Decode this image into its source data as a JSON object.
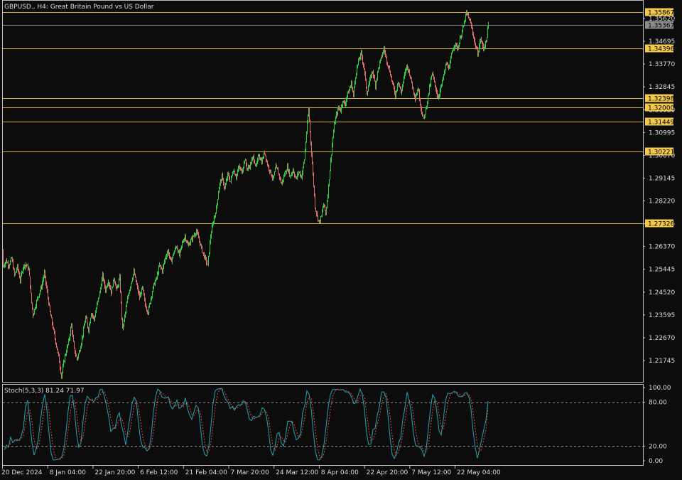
{
  "header": {
    "symbol_title": "GBPUSD., H4:  Great Britain Pound vs US Dollar"
  },
  "colors": {
    "background": "#0c0c0c",
    "frame": "#bdbdbd",
    "level_line": "#d8b233",
    "level_badge": "#f2c94c",
    "current_price_line": "#8a8a8a",
    "current_price_badge": "#8c8c8c",
    "bull_candle": "#2ecc40",
    "bear_candle": "#e06c6c",
    "stoch_main": "#1fa6b2",
    "stoch_signal": "#d94a4a",
    "stoch_levels": "#8a8a8a"
  },
  "chart_data": {
    "type": "candlestick",
    "symbol": "GBPUSD.",
    "timeframe": "H4",
    "price_axis_ticks": [
      "1.35620",
      "1.34695",
      "1.33770",
      "1.32845",
      "1.31920",
      "1.30995",
      "1.30070",
      "1.29145",
      "1.28220",
      "1.27295",
      "1.26370",
      "1.25445",
      "1.24520",
      "1.23595",
      "1.22670",
      "1.21745"
    ],
    "price_range": [
      1.2125,
      1.3605
    ],
    "horizontal_levels": [
      "1.35867",
      "1.34396",
      "1.32398",
      "1.32000",
      "1.31449",
      "1.30221",
      "1.27326"
    ],
    "current_price": "1.35367",
    "time_axis_labels": [
      "20 Dec 2024",
      "8 Jan 04:00",
      "22 Jan 20:00",
      "6 Feb 12:00",
      "21 Feb 04:00",
      "7 Mar 20:00",
      "24 Mar 12:00",
      "8 Apr 04:00",
      "22 Apr 20:00",
      "7 May 12:00",
      "22 May 04:00"
    ],
    "price_path": [
      [
        0,
        1.262
      ],
      [
        4,
        1.2555
      ],
      [
        8,
        1.258
      ],
      [
        12,
        1.256
      ],
      [
        16,
        1.259
      ],
      [
        20,
        1.252
      ],
      [
        24,
        1.2555
      ],
      [
        28,
        1.25
      ],
      [
        32,
        1.2555
      ],
      [
        36,
        1.2565
      ],
      [
        40,
        1.2545
      ],
      [
        44,
        1.241
      ],
      [
        46,
        1.236
      ],
      [
        52,
        1.2425
      ],
      [
        58,
        1.2475
      ],
      [
        62,
        1.253
      ],
      [
        66,
        1.245
      ],
      [
        70,
        1.237
      ],
      [
        74,
        1.231
      ],
      [
        78,
        1.225
      ],
      [
        82,
        1.219
      ],
      [
        86,
        1.211
      ],
      [
        90,
        1.218
      ],
      [
        96,
        1.225
      ],
      [
        100,
        1.232
      ],
      [
        104,
        1.222
      ],
      [
        108,
        1.218
      ],
      [
        112,
        1.222
      ],
      [
        116,
        1.228
      ],
      [
        120,
        1.235
      ],
      [
        124,
        1.23
      ],
      [
        128,
        1.237
      ],
      [
        132,
        1.234
      ],
      [
        136,
        1.24
      ],
      [
        140,
        1.245
      ],
      [
        144,
        1.252
      ],
      [
        148,
        1.246
      ],
      [
        152,
        1.25
      ],
      [
        156,
        1.245
      ],
      [
        160,
        1.251
      ],
      [
        164,
        1.246
      ],
      [
        168,
        1.251
      ],
      [
        172,
        1.23
      ],
      [
        176,
        1.237
      ],
      [
        180,
        1.244
      ],
      [
        184,
        1.249
      ],
      [
        188,
        1.2535
      ],
      [
        192,
        1.248
      ],
      [
        196,
        1.243
      ],
      [
        200,
        1.247
      ],
      [
        204,
        1.24
      ],
      [
        208,
        1.237
      ],
      [
        212,
        1.243
      ],
      [
        216,
        1.248
      ],
      [
        220,
        1.251
      ],
      [
        224,
        1.256
      ],
      [
        228,
        1.254
      ],
      [
        232,
        1.259
      ],
      [
        236,
        1.262
      ],
      [
        240,
        1.2575
      ],
      [
        244,
        1.261
      ],
      [
        248,
        1.264
      ],
      [
        252,
        1.26
      ],
      [
        256,
        1.265
      ],
      [
        260,
        1.268
      ],
      [
        264,
        1.264
      ],
      [
        268,
        1.266
      ],
      [
        272,
        1.268
      ],
      [
        276,
        1.27
      ],
      [
        280,
        1.266
      ],
      [
        284,
        1.262
      ],
      [
        288,
        1.259
      ],
      [
        292,
        1.256
      ],
      [
        296,
        1.268
      ],
      [
        300,
        1.274
      ],
      [
        304,
        1.279
      ],
      [
        308,
        1.288
      ],
      [
        312,
        1.292
      ],
      [
        316,
        1.287
      ],
      [
        320,
        1.293
      ],
      [
        324,
        1.29
      ],
      [
        328,
        1.295
      ],
      [
        332,
        1.292
      ],
      [
        336,
        1.296
      ],
      [
        340,
        1.294
      ],
      [
        344,
        1.299
      ],
      [
        348,
        1.295
      ],
      [
        352,
        1.297
      ],
      [
        356,
        1.3
      ],
      [
        360,
        1.296
      ],
      [
        364,
        1.301
      ],
      [
        368,
        1.298
      ],
      [
        372,
        1.302
      ],
      [
        376,
        1.297
      ],
      [
        380,
        1.294
      ],
      [
        384,
        1.291
      ],
      [
        388,
        1.296
      ],
      [
        392,
        1.293
      ],
      [
        396,
        1.289
      ],
      [
        400,
        1.293
      ],
      [
        404,
        1.296
      ],
      [
        408,
        1.292
      ],
      [
        412,
        1.295
      ],
      [
        416,
        1.291
      ],
      [
        420,
        1.294
      ],
      [
        424,
        1.292
      ],
      [
        428,
        1.299
      ],
      [
        431,
        1.31
      ],
      [
        434,
        1.3195
      ],
      [
        437,
        1.306
      ],
      [
        440,
        1.293
      ],
      [
        443,
        1.28
      ],
      [
        446,
        1.276
      ],
      [
        449,
        1.2735
      ],
      [
        452,
        1.276
      ],
      [
        455,
        1.281
      ],
      [
        458,
        1.277
      ],
      [
        461,
        1.285
      ],
      [
        464,
        1.295
      ],
      [
        467,
        1.305
      ],
      [
        470,
        1.313
      ],
      [
        473,
        1.317
      ],
      [
        476,
        1.32
      ],
      [
        479,
        1.319
      ],
      [
        482,
        1.323
      ],
      [
        485,
        1.321
      ],
      [
        488,
        1.325
      ],
      [
        491,
        1.327
      ],
      [
        494,
        1.33
      ],
      [
        497,
        1.325
      ],
      [
        500,
        1.333
      ],
      [
        504,
        1.339
      ],
      [
        508,
        1.342
      ],
      [
        512,
        1.336
      ],
      [
        516,
        1.326
      ],
      [
        520,
        1.331
      ],
      [
        524,
        1.335
      ],
      [
        528,
        1.329
      ],
      [
        532,
        1.336
      ],
      [
        536,
        1.34
      ],
      [
        540,
        1.344
      ],
      [
        544,
        1.339
      ],
      [
        548,
        1.335
      ],
      [
        552,
        1.33
      ],
      [
        556,
        1.325
      ],
      [
        560,
        1.331
      ],
      [
        564,
        1.326
      ],
      [
        568,
        1.332
      ],
      [
        572,
        1.337
      ],
      [
        576,
        1.334
      ],
      [
        580,
        1.329
      ],
      [
        584,
        1.324
      ],
      [
        588,
        1.328
      ],
      [
        592,
        1.32
      ],
      [
        596,
        1.315
      ],
      [
        600,
        1.321
      ],
      [
        604,
        1.328
      ],
      [
        608,
        1.334
      ],
      [
        612,
        1.329
      ],
      [
        616,
        1.324
      ],
      [
        620,
        1.328
      ],
      [
        624,
        1.333
      ],
      [
        628,
        1.338
      ],
      [
        632,
        1.336
      ],
      [
        636,
        1.343
      ],
      [
        640,
        1.346
      ],
      [
        644,
        1.344
      ],
      [
        648,
        1.349
      ],
      [
        652,
        1.353
      ],
      [
        656,
        1.3585
      ],
      [
        660,
        1.356
      ],
      [
        664,
        1.352
      ],
      [
        668,
        1.346
      ],
      [
        672,
        1.342
      ],
      [
        676,
        1.348
      ],
      [
        680,
        1.344
      ],
      [
        684,
        1.347
      ],
      [
        687,
        1.3537
      ]
    ],
    "stochastic": {
      "label": "Stoch(5,3,3) 81.24 71.97",
      "params": [
        5,
        3,
        3
      ],
      "main_value": 81.24,
      "signal_value": 71.97,
      "levels": [
        "80.00",
        "20.00"
      ],
      "axis_ticks": [
        "100.00",
        "80.00",
        "20.00",
        "0.00"
      ],
      "range": [
        0,
        100
      ]
    }
  }
}
